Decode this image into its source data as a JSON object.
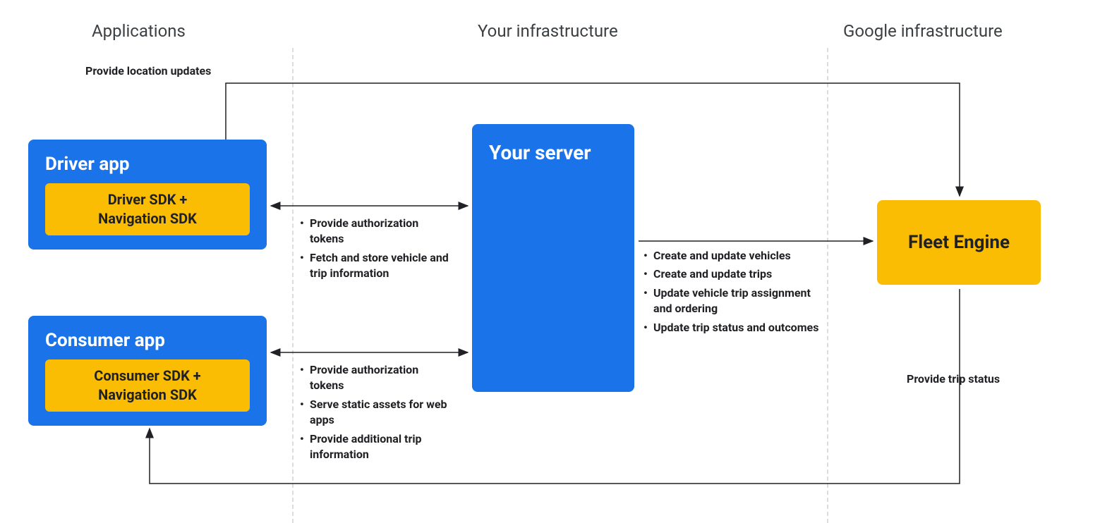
{
  "sections": {
    "applications": "Applications",
    "your_infra": "Your infrastructure",
    "google_infra": "Google infrastructure"
  },
  "driver_app": {
    "title": "Driver app",
    "sdk": "Driver SDK +\nNavigation SDK"
  },
  "consumer_app": {
    "title": "Consumer app",
    "sdk": "Consumer SDK +\nNavigation SDK"
  },
  "your_server": "Your server",
  "fleet_engine": "Fleet Engine",
  "labels": {
    "provide_location": "Provide location updates",
    "provide_trip_status": "Provide trip status"
  },
  "driver_server_notes": [
    "Provide authorization tokens",
    "Fetch and store vehicle and trip information"
  ],
  "consumer_server_notes": [
    "Provide authorization tokens",
    "Serve static assets for web apps",
    "Provide additional trip information"
  ],
  "server_fleet_notes": [
    "Create and update vehicles",
    "Create and update trips",
    "Update vehicle trip assignment and ordering",
    "Update trip status and outcomes"
  ]
}
